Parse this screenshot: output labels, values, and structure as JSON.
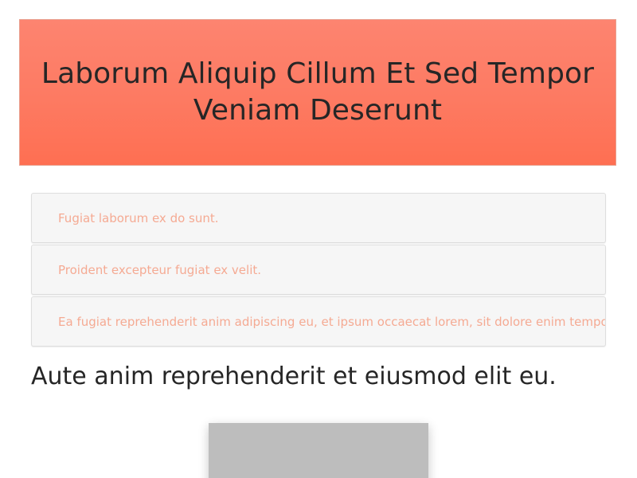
{
  "hero": {
    "title": "Laborum Aliquip Cillum Et Sed Tempor Veniam Deserunt"
  },
  "list": {
    "items": [
      {
        "text": "Fugiat laborum ex do sunt."
      },
      {
        "text": "Proident excepteur fugiat ex velit."
      },
      {
        "text": "Ea fugiat reprehenderit anim adipiscing eu, et ipsum occaecat lorem, sit dolore enim tempor."
      }
    ]
  },
  "section": {
    "heading": "Aute anim reprehenderit et eiusmod elit eu."
  },
  "colors": {
    "hero_background": "#fd7a62",
    "list_text": "#f5aa93",
    "list_background": "#f6f6f6",
    "image_placeholder": "#bdbdbd"
  }
}
